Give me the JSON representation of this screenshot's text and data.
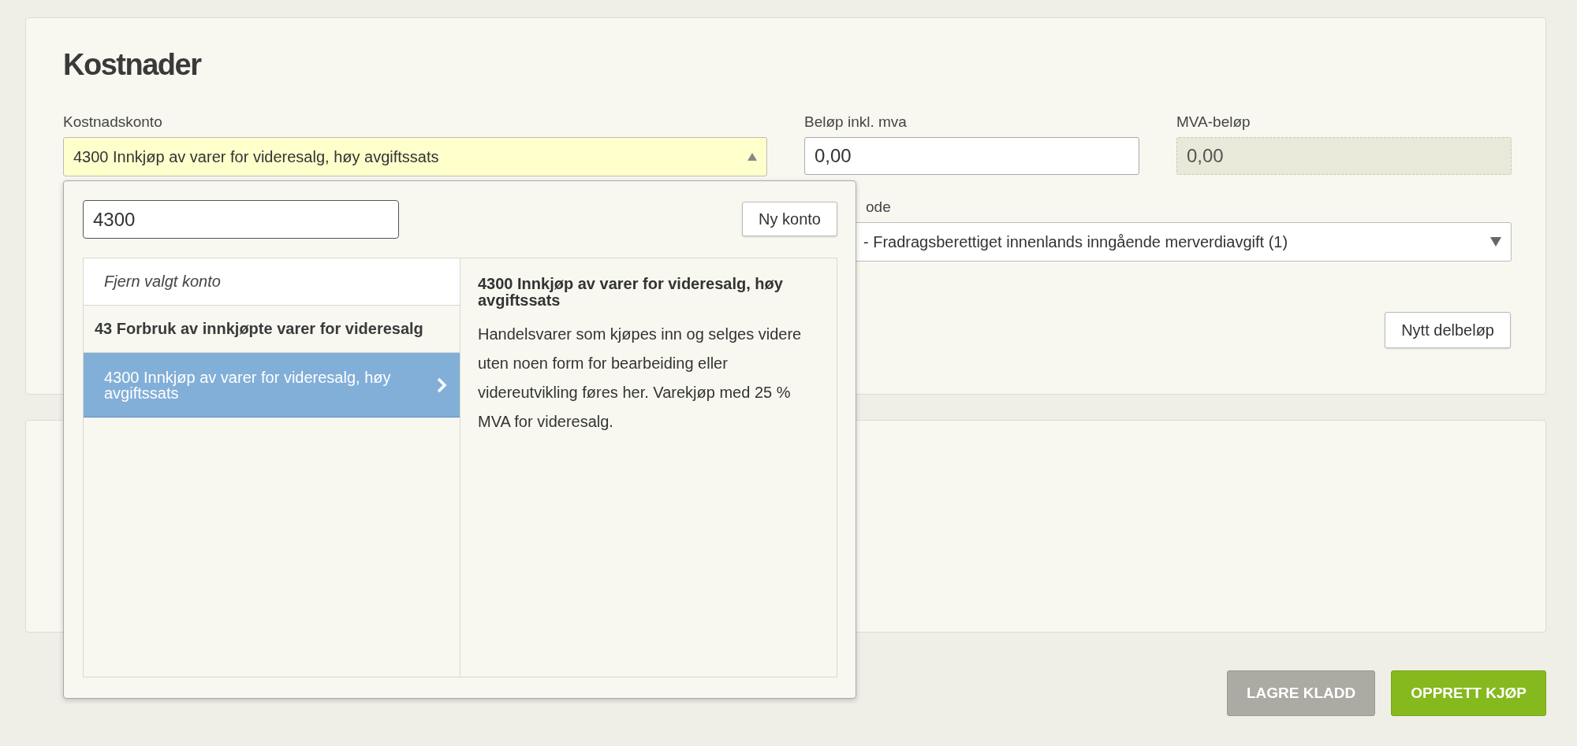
{
  "title": "Kostnader",
  "account_field": {
    "label": "Kostnadskonto",
    "value": "4300 Innkjøp av varer for videresalg, høy avgiftssats",
    "expanded": true
  },
  "amount_field": {
    "label": "Beløp inkl. mva",
    "value": "0,00"
  },
  "vat_field": {
    "label": "MVA-beløp",
    "value": "0,00",
    "disabled": true
  },
  "vat_code_field": {
    "label": "ode",
    "value": "- Fradragsberettiget innenlands inngående merverdiavgift (1)"
  },
  "add_part_button": "Nytt delbeløp",
  "dropdown": {
    "search_value": "4300",
    "new_account_button": "Ny konto",
    "items": [
      {
        "kind": "clear",
        "label": "Fjern valgt konto",
        "selected": false
      },
      {
        "kind": "group",
        "label": "43 Forbruk av innkjøpte varer for videresalg",
        "selected": false
      },
      {
        "kind": "account",
        "label": "4300 Innkjøp av varer for videresalg, høy avgiftssats",
        "selected": true
      }
    ],
    "detail": {
      "title": "4300 Innkjøp av varer for videresalg, høy avgiftssats",
      "description": "Handelsvarer som kjøpes inn og selges videre uten noen form for bearbeiding eller videreutvikling føres her. Varekjøp med 25 % MVA for videresalg."
    }
  },
  "buttons": [
    {
      "kind": "secondary",
      "label": "LAGRE KLADD"
    },
    {
      "kind": "primary",
      "label": "OPPRETT KJØP"
    }
  ]
}
